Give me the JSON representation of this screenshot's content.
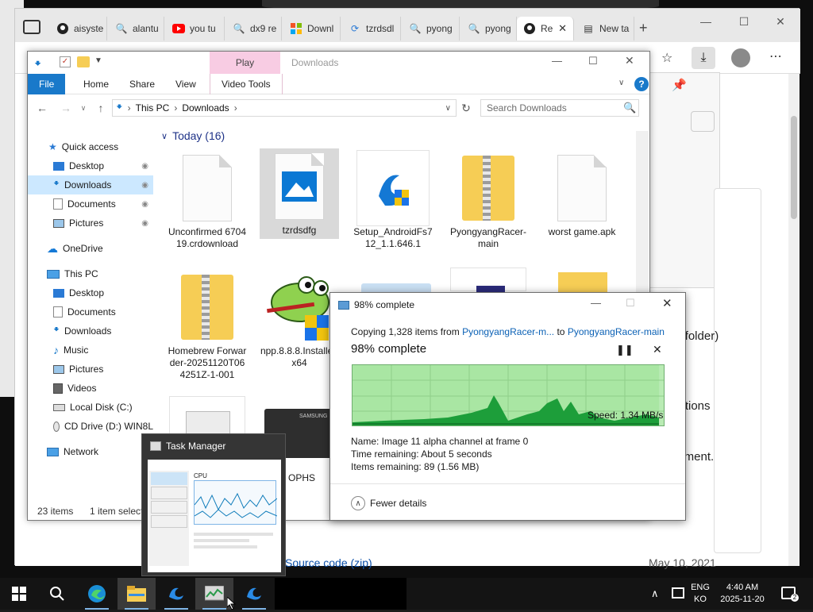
{
  "browser": {
    "tabs": [
      {
        "label": "aisyste"
      },
      {
        "label": "alantu"
      },
      {
        "label": "you tu"
      },
      {
        "label": "dx9 re"
      },
      {
        "label": "Downl"
      },
      {
        "label": "tzrdsdl"
      },
      {
        "label": "pyong"
      },
      {
        "label": "pyong"
      },
      {
        "label": "Re"
      },
      {
        "label": "New ta"
      }
    ],
    "page_snippets": {
      "folder": "s folder)",
      "cations": "cations",
      "onment": "onment.",
      "source_code": "Source code (zip)",
      "date": "May 10, 2021"
    }
  },
  "explorer": {
    "title": "Downloads",
    "ribbon_tabs": [
      "File",
      "Home",
      "Share",
      "View",
      "Video Tools"
    ],
    "play_tab": "Play",
    "breadcrumb": [
      "This PC",
      "Downloads"
    ],
    "search_placeholder": "Search Downloads",
    "group_header": "Today (16)",
    "nav": {
      "quick_access": "Quick access",
      "qa_items": [
        "Desktop",
        "Downloads",
        "Documents",
        "Pictures"
      ],
      "onedrive": "OneDrive",
      "this_pc": "This PC",
      "pc_items": [
        "Desktop",
        "Documents",
        "Downloads",
        "Music",
        "Pictures",
        "Videos",
        "Local Disk (C:)",
        "CD Drive (D:) WIN8L"
      ],
      "network": "Network"
    },
    "files": [
      {
        "name": "Unconfirmed 670419.crdownload"
      },
      {
        "name": "tzrdsdfg"
      },
      {
        "name": "Setup_AndroidFs712_1.1.646.1"
      },
      {
        "name": "PyongyangRacer-main"
      },
      {
        "name": "worst game.apk"
      },
      {
        "name": "Homebrew Forwarder-20251120T064251Z-1-001"
      },
      {
        "name": "npp.8.8.8.Installer.x64"
      },
      {
        "name": "OPHS"
      }
    ],
    "status": {
      "items": "23 items",
      "selected": "1 item selecte"
    }
  },
  "copy_dialog": {
    "title": "98% complete",
    "copying_prefix": "Copying 1,328 items from ",
    "source": "PyongyangRacer-m...",
    "to_word": " to ",
    "dest": "PyongyangRacer-main",
    "heading": "98% complete",
    "progress_fraction": 0.98,
    "speed": "Speed: 1.34 MB/s",
    "name_line": "Name:  Image 11 alpha channel at frame 0",
    "time_line": "Time remaining:  About 5 seconds",
    "items_line": "Items remaining:  89 (1.56 MB)",
    "fewer_details": "Fewer details"
  },
  "task_preview": {
    "title": "Task Manager",
    "cpu_label": "CPU"
  },
  "taskbar": {
    "lang_top": "ENG",
    "lang_bottom": "KO",
    "time": "4:40 AM",
    "date": "2025-11-20"
  },
  "colors": {
    "accent": "#1979ca",
    "graph_fill": "#1d9e3a",
    "graph_bg": "#b9ebb4",
    "selection": "#cce8ff"
  }
}
